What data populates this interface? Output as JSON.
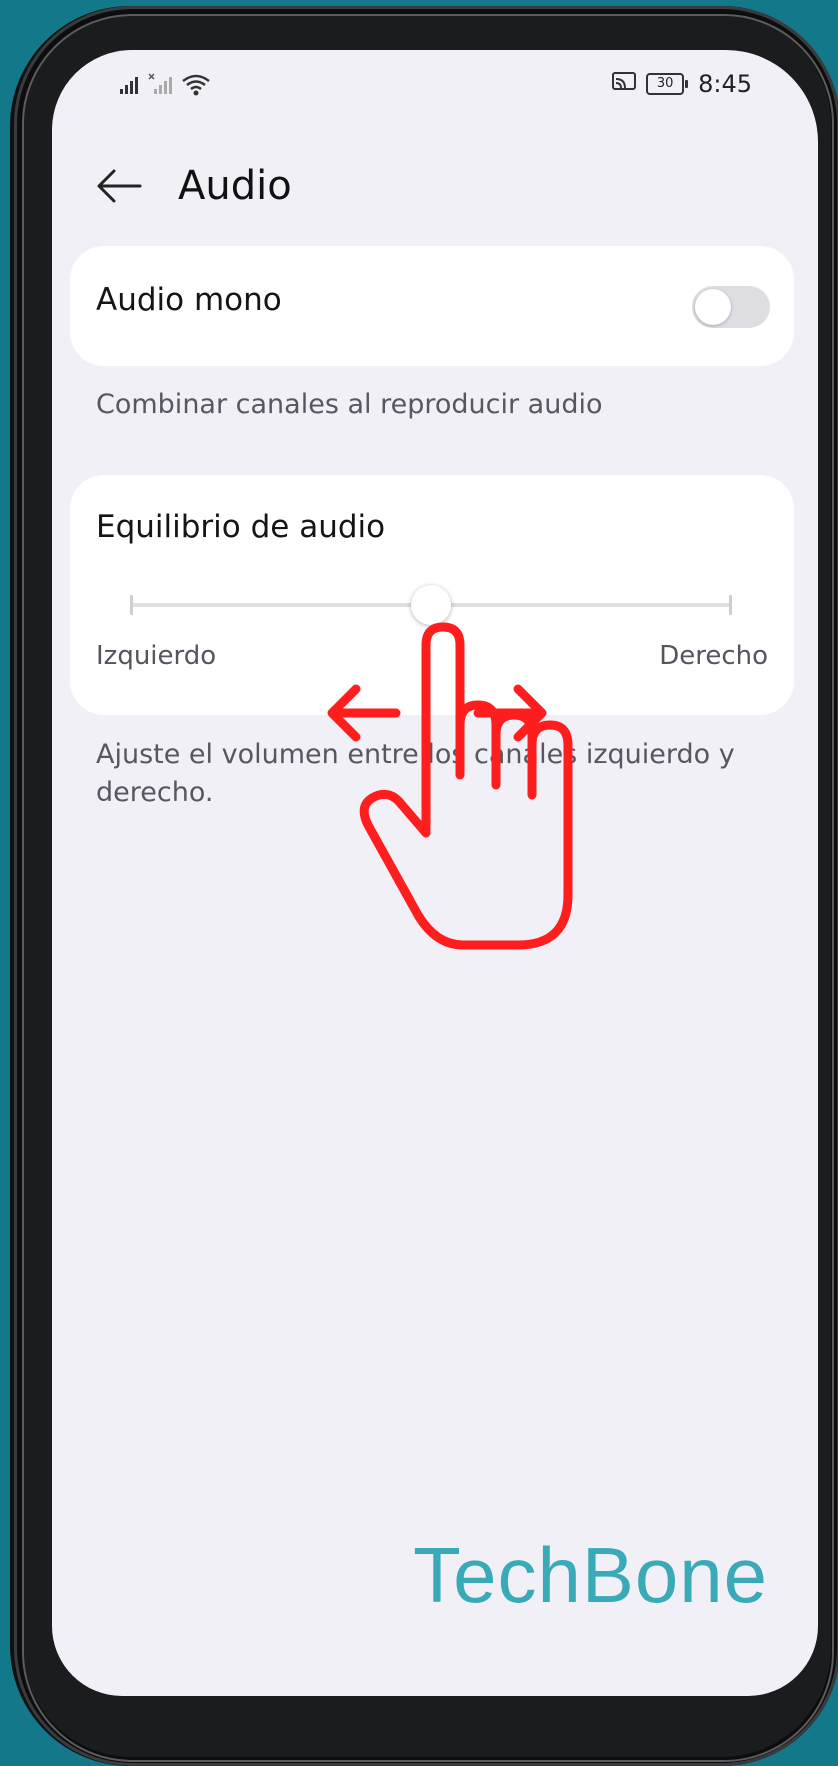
{
  "status_bar": {
    "time": "8:45",
    "battery": "30"
  },
  "header": {
    "title": "Audio"
  },
  "audio_mono": {
    "label": "Audio mono",
    "enabled": false,
    "description": "Combinar canales al reproducir audio"
  },
  "audio_balance": {
    "label": "Equilibrio de audio",
    "left_label": "Izquierdo",
    "right_label": "Derecho",
    "value": 0.5,
    "description": "Ajuste el volumen entre los canales izquierdo y derecho."
  },
  "overlay": {
    "icon": "swipe-horizontal-hand-icon",
    "color": "#ff1e1e"
  },
  "watermark": "TechBone",
  "colors": {
    "background": "#13798a",
    "screen": "#f1f0f7",
    "card": "#ffffff",
    "watermark": "#3aaab9"
  }
}
